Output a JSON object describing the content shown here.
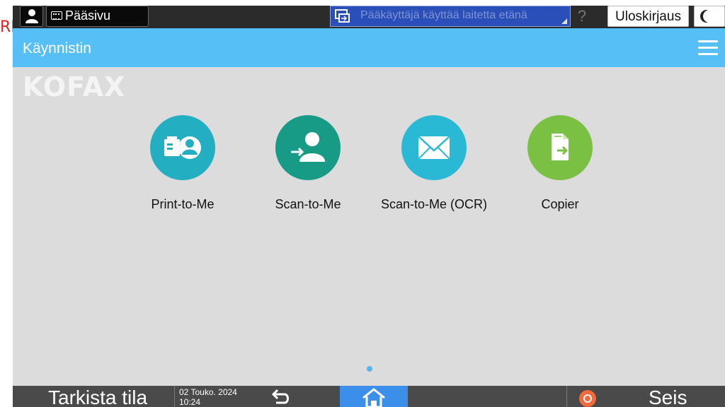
{
  "crop_artifact": "RE",
  "topbar": {
    "home_tab_label": "Pääsivu",
    "remote_notice": "Pääkäyttäjä käyttää laitetta etänä",
    "help_label": "?",
    "logout_label": "Uloskirjaus"
  },
  "header": {
    "title": "Käynnistin"
  },
  "content": {
    "brand": "KOFAX",
    "apps": [
      {
        "label": "Print-to-Me",
        "icon": "print-to-me-icon",
        "color": "#23aec2"
      },
      {
        "label": "Scan-to-Me",
        "icon": "scan-to-me-icon",
        "color": "#179a86"
      },
      {
        "label": "Scan-to-Me (OCR)",
        "icon": "envelope-icon",
        "color": "#2ab9d4"
      },
      {
        "label": "Copier",
        "icon": "copier-icon",
        "color": "#7ac143"
      }
    ],
    "pages": 1
  },
  "bottombar": {
    "check_status_label": "Tarkista tila",
    "date": "02 Touko. 2024",
    "time": "10:24",
    "stop_label": "Seis"
  },
  "colors": {
    "header": "#56bff5",
    "home_button": "#3b8fe8",
    "stop": "#f06a3c"
  }
}
